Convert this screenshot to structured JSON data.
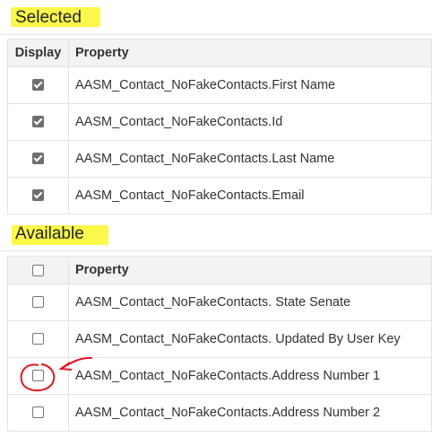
{
  "selected": {
    "title": "Selected",
    "headers": {
      "display": "Display",
      "property": "Property"
    },
    "rows": [
      {
        "property": "AASM_Contact_NoFakeContacts.First Name",
        "checked": true
      },
      {
        "property": "AASM_Contact_NoFakeContacts.Id",
        "checked": true
      },
      {
        "property": "AASM_Contact_NoFakeContacts.Last Name",
        "checked": true
      },
      {
        "property": "AASM_Contact_NoFakeContacts.Email",
        "checked": true
      }
    ]
  },
  "available": {
    "title": "Available",
    "headers": {
      "property": "Property"
    },
    "select_all_checked": false,
    "rows": [
      {
        "property": "AASM_Contact_NoFakeContacts. State Senate",
        "checked": false
      },
      {
        "property": "AASM_Contact_NoFakeContacts. Updated By User Key",
        "checked": false
      },
      {
        "property": "AASM_Contact_NoFakeContacts.Address Number 1",
        "checked": false
      },
      {
        "property": "AASM_Contact_NoFakeContacts.Address Number 2",
        "checked": false
      }
    ]
  },
  "colors": {
    "highlight": "#fbf84a",
    "annotation": "#e0191f",
    "header_bg": "#f3f3f3"
  }
}
